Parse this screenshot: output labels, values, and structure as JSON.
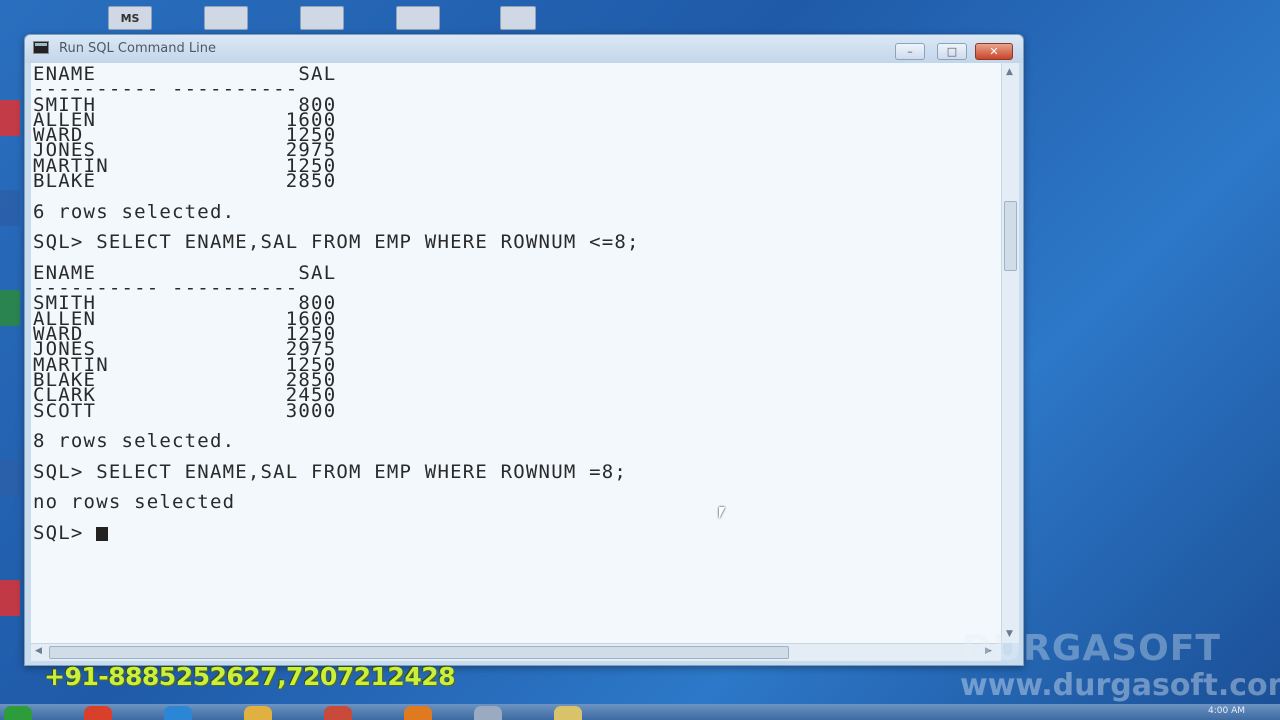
{
  "desktop": {
    "top_icon_label": "MS"
  },
  "window": {
    "title": "Run SQL Command Line",
    "minimize": "–",
    "maximize": "□",
    "close": "✕"
  },
  "console": {
    "lines": [
      "ENAME                SAL",
      "---------- ----------",
      "SMITH                800",
      "ALLEN               1600",
      "WARD                1250",
      "JONES               2975",
      "MARTIN              1250",
      "BLAKE               2850",
      "",
      "6 rows selected.",
      "",
      "SQL> SELECT ENAME,SAL FROM EMP WHERE ROWNUM <=8;",
      "",
      "ENAME                SAL",
      "---------- ----------",
      "SMITH                800",
      "ALLEN               1600",
      "WARD                1250",
      "JONES               2975",
      "MARTIN              1250",
      "BLAKE               2850",
      "CLARK               2450",
      "SCOTT               3000",
      "",
      "8 rows selected.",
      "",
      "SQL> SELECT ENAME,SAL FROM EMP WHERE ROWNUM =8;",
      "",
      "no rows selected",
      "",
      "SQL> "
    ]
  },
  "watermark": {
    "phone": "+91-8885252627,7207212428",
    "brand": "DURGASOFT",
    "url": "www.durgasoft.com"
  },
  "taskbar": {
    "clock": "4:00 AM"
  },
  "colors": {
    "console_bg": "#f2f8fc",
    "console_text": "#2a2a2a",
    "phone_text": "#c8f03c"
  }
}
